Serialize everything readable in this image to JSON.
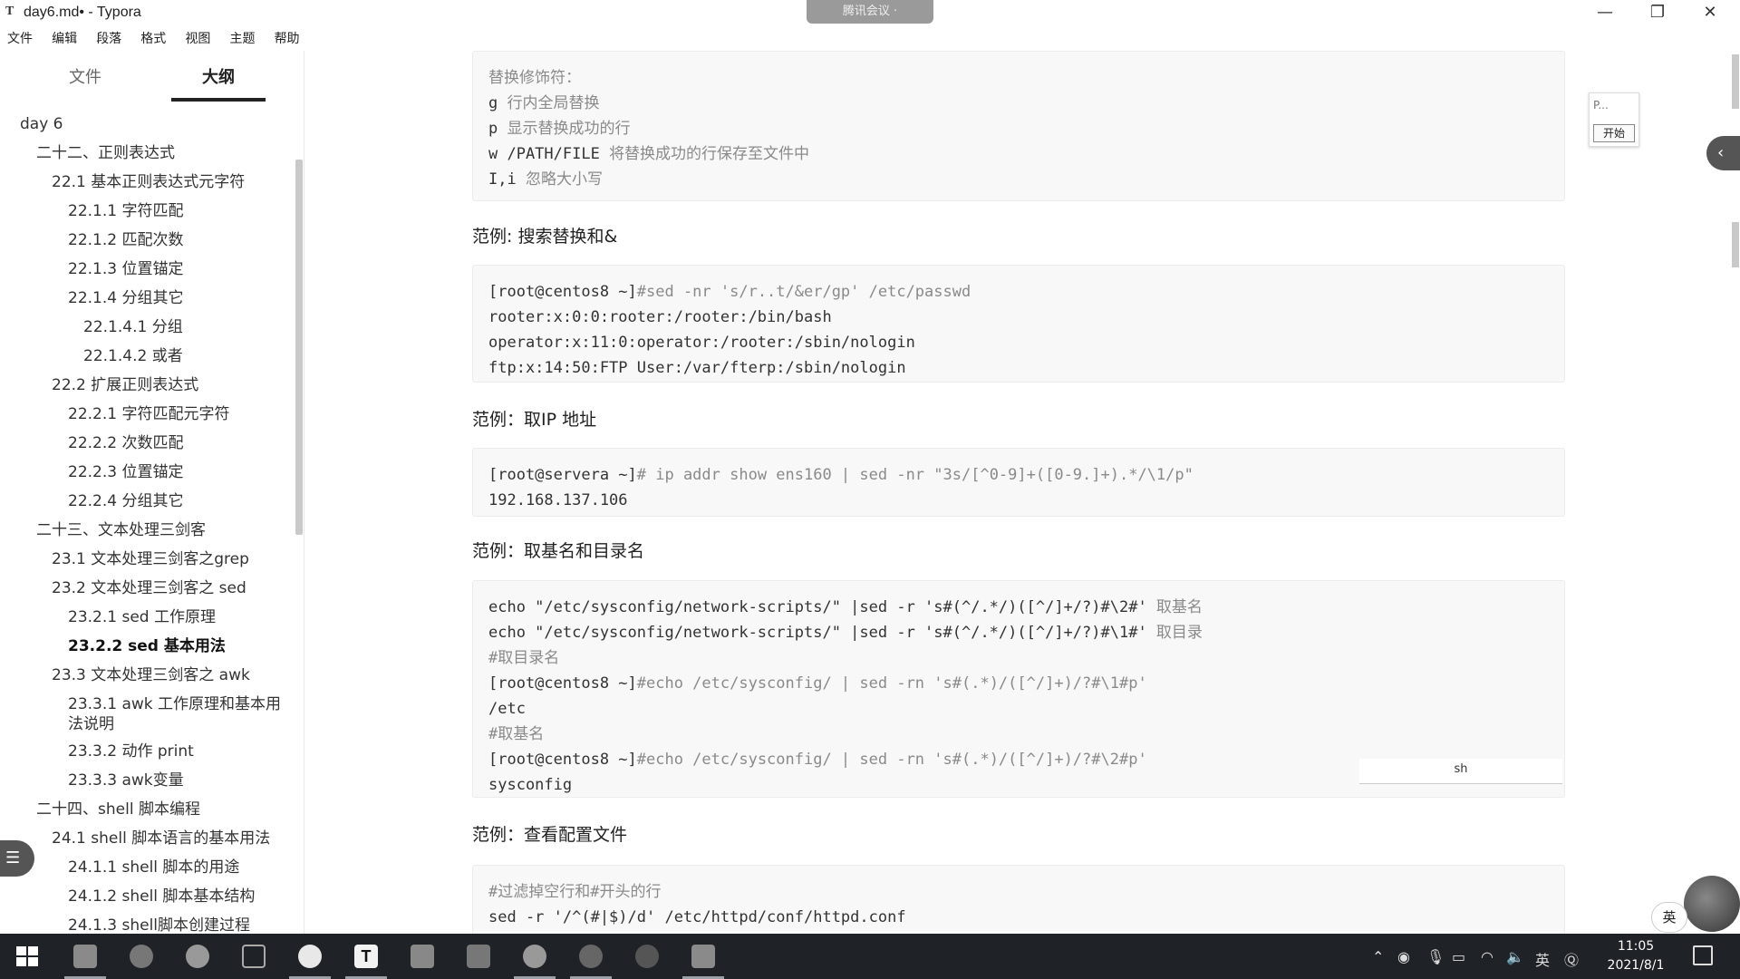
{
  "window": {
    "app_icon": "T",
    "title": "day6.md• - Typora",
    "meeting_label": "腾讯会议 ·",
    "minimize": "—",
    "restore": "❐",
    "close": "✕"
  },
  "menu": [
    "文件",
    "编辑",
    "段落",
    "格式",
    "视图",
    "主题",
    "帮助"
  ],
  "sidebar": {
    "tabs": [
      "文件",
      "大纲"
    ],
    "outline": [
      {
        "text": "day 6",
        "level": 0
      },
      {
        "text": "二十二、正则表达式",
        "level": 1
      },
      {
        "text": "22.1 基本正则表达式元字符",
        "level": 2
      },
      {
        "text": "22.1.1 字符匹配",
        "level": 3
      },
      {
        "text": "22.1.2 匹配次数",
        "level": 3
      },
      {
        "text": "22.1.3 位置锚定",
        "level": 3
      },
      {
        "text": "22.1.4 分组其它",
        "level": 3
      },
      {
        "text": "22.1.4.1 分组",
        "level": 4
      },
      {
        "text": "22.1.4.2 或者",
        "level": 4
      },
      {
        "text": "22.2 扩展正则表达式",
        "level": 2
      },
      {
        "text": "22.2.1 字符匹配元字符",
        "level": 3
      },
      {
        "text": "22.2.2 次数匹配",
        "level": 3
      },
      {
        "text": "22.2.3 位置锚定",
        "level": 3
      },
      {
        "text": "22.2.4 分组其它",
        "level": 3
      },
      {
        "text": "二十三、文本处理三剑客",
        "level": 1
      },
      {
        "text": "23.1 文本处理三剑客之grep",
        "level": 2
      },
      {
        "text": "23.2 文本处理三剑客之 sed",
        "level": 2
      },
      {
        "text": "23.2.1 sed 工作原理",
        "level": 3
      },
      {
        "text": "23.2.2 sed 基本用法",
        "level": 3,
        "active": true
      },
      {
        "text": "23.3 文本处理三剑客之 awk",
        "level": 2
      },
      {
        "text": "23.3.1 awk 工作原理和基本用",
        "level": 3
      },
      {
        "text": "法说明",
        "level": 3
      },
      {
        "text": "23.3.2 动作 print",
        "level": 3
      },
      {
        "text": "23.3.3 awk变量",
        "level": 3
      },
      {
        "text": "二十四、shell 脚本编程",
        "level": 1
      },
      {
        "text": "24.1 shell 脚本语言的基本用法",
        "level": 2
      },
      {
        "text": "24.1.1 shell 脚本的用途",
        "level": 3
      },
      {
        "text": "24.1.2 shell 脚本基本结构",
        "level": 3
      },
      {
        "text": "24.1.3 shell脚本创建过程",
        "level": 3
      }
    ],
    "bottom_left": "‹",
    "bottom_right": "</>"
  },
  "editor": {
    "block1": [
      {
        "text": "替换修饰符：",
        "comment": true
      },
      {
        "code": "g ",
        "note": "行内全局替换"
      },
      {
        "code": "p ",
        "note": "显示替换成功的行"
      },
      {
        "code": "w /PATH/FILE ",
        "note": "将替换成功的行保存至文件中"
      },
      {
        "code": "I,i ",
        "note": "忽略大小写"
      }
    ],
    "heading1": "范例: 搜索替换和&",
    "block2": [
      {
        "code": "[root@centos8 ~]",
        "rest": "#sed -nr 's/r..t/&er/gp' /etc/passwd"
      },
      {
        "code": "rooter:x:0:0:rooter:/rooter:/bin/bash",
        "rest": ""
      },
      {
        "code": "operator:x:11:0:operator:/rooter:/sbin/nologin",
        "rest": ""
      },
      {
        "code": "ftp:x:14:50:FTP User:/var/fterp:/sbin/nologin",
        "rest": ""
      }
    ],
    "heading2": "范例：取IP 地址",
    "block3": [
      {
        "code": "[root@servera ~]",
        "rest": "# ip addr show ens160 | sed -nr \"3s/[^0-9]+([0-9.]+).*/\\1/p\""
      },
      {
        "code": "192.168.137.106",
        "rest": ""
      }
    ],
    "heading3": "范例：取基名和目录名",
    "block4": [
      {
        "code": "echo \"/etc/sysconfig/network-scripts/\" |sed -r 's#(^/.*/)([^/]+/?)#\\2#' ",
        "note": "取基名"
      },
      {
        "code": "echo \"/etc/sysconfig/network-scripts/\" |sed -r 's#(^/.*/)([^/]+/?)#\\1#' ",
        "note": "取目录"
      },
      {
        "code": "",
        "note": "#取目录名"
      },
      {
        "code": "[root@centos8 ~]",
        "rest": "#echo /etc/sysconfig/ | sed -rn 's#(.*)/([^/]+)/?#\\1#p'"
      },
      {
        "code": "/etc",
        "rest": ""
      },
      {
        "code": "",
        "note": "#取基名"
      },
      {
        "code": "[root@centos8 ~]",
        "rest": "#echo /etc/sysconfig/ | sed -rn 's#(.*)/([^/]+)/?#\\2#p'"
      },
      {
        "code": "sysconfig",
        "rest": ""
      }
    ],
    "lang_tag": "sh",
    "heading4": "范例：查看配置文件",
    "block5": [
      {
        "code": "",
        "note": "#过滤掉空行和#开头的行"
      },
      {
        "code": "sed -r '/^(#|$)/d' /etc/httpd/conf/httpd.conf",
        "rest": ""
      }
    ]
  },
  "float_widget": {
    "top": "P...",
    "button": "开始"
  },
  "ime": "英",
  "taskbar": {
    "time": "11:05",
    "date": "2021/8/1",
    "tray_lang": "英"
  }
}
